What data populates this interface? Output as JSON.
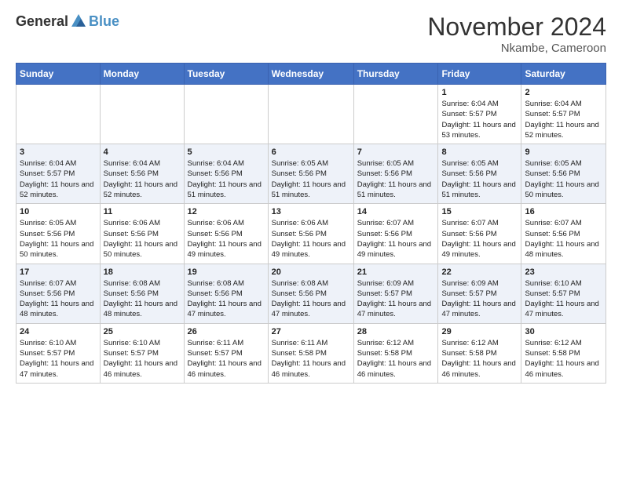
{
  "header": {
    "logo_general": "General",
    "logo_blue": "Blue",
    "month": "November 2024",
    "location": "Nkambe, Cameroon"
  },
  "weekdays": [
    "Sunday",
    "Monday",
    "Tuesday",
    "Wednesday",
    "Thursday",
    "Friday",
    "Saturday"
  ],
  "weeks": [
    [
      {
        "day": "",
        "sunrise": "",
        "sunset": "",
        "daylight": ""
      },
      {
        "day": "",
        "sunrise": "",
        "sunset": "",
        "daylight": ""
      },
      {
        "day": "",
        "sunrise": "",
        "sunset": "",
        "daylight": ""
      },
      {
        "day": "",
        "sunrise": "",
        "sunset": "",
        "daylight": ""
      },
      {
        "day": "",
        "sunrise": "",
        "sunset": "",
        "daylight": ""
      },
      {
        "day": "1",
        "sunrise": "Sunrise: 6:04 AM",
        "sunset": "Sunset: 5:57 PM",
        "daylight": "Daylight: 11 hours and 53 minutes."
      },
      {
        "day": "2",
        "sunrise": "Sunrise: 6:04 AM",
        "sunset": "Sunset: 5:57 PM",
        "daylight": "Daylight: 11 hours and 52 minutes."
      }
    ],
    [
      {
        "day": "3",
        "sunrise": "Sunrise: 6:04 AM",
        "sunset": "Sunset: 5:57 PM",
        "daylight": "Daylight: 11 hours and 52 minutes."
      },
      {
        "day": "4",
        "sunrise": "Sunrise: 6:04 AM",
        "sunset": "Sunset: 5:56 PM",
        "daylight": "Daylight: 11 hours and 52 minutes."
      },
      {
        "day": "5",
        "sunrise": "Sunrise: 6:04 AM",
        "sunset": "Sunset: 5:56 PM",
        "daylight": "Daylight: 11 hours and 51 minutes."
      },
      {
        "day": "6",
        "sunrise": "Sunrise: 6:05 AM",
        "sunset": "Sunset: 5:56 PM",
        "daylight": "Daylight: 11 hours and 51 minutes."
      },
      {
        "day": "7",
        "sunrise": "Sunrise: 6:05 AM",
        "sunset": "Sunset: 5:56 PM",
        "daylight": "Daylight: 11 hours and 51 minutes."
      },
      {
        "day": "8",
        "sunrise": "Sunrise: 6:05 AM",
        "sunset": "Sunset: 5:56 PM",
        "daylight": "Daylight: 11 hours and 51 minutes."
      },
      {
        "day": "9",
        "sunrise": "Sunrise: 6:05 AM",
        "sunset": "Sunset: 5:56 PM",
        "daylight": "Daylight: 11 hours and 50 minutes."
      }
    ],
    [
      {
        "day": "10",
        "sunrise": "Sunrise: 6:05 AM",
        "sunset": "Sunset: 5:56 PM",
        "daylight": "Daylight: 11 hours and 50 minutes."
      },
      {
        "day": "11",
        "sunrise": "Sunrise: 6:06 AM",
        "sunset": "Sunset: 5:56 PM",
        "daylight": "Daylight: 11 hours and 50 minutes."
      },
      {
        "day": "12",
        "sunrise": "Sunrise: 6:06 AM",
        "sunset": "Sunset: 5:56 PM",
        "daylight": "Daylight: 11 hours and 49 minutes."
      },
      {
        "day": "13",
        "sunrise": "Sunrise: 6:06 AM",
        "sunset": "Sunset: 5:56 PM",
        "daylight": "Daylight: 11 hours and 49 minutes."
      },
      {
        "day": "14",
        "sunrise": "Sunrise: 6:07 AM",
        "sunset": "Sunset: 5:56 PM",
        "daylight": "Daylight: 11 hours and 49 minutes."
      },
      {
        "day": "15",
        "sunrise": "Sunrise: 6:07 AM",
        "sunset": "Sunset: 5:56 PM",
        "daylight": "Daylight: 11 hours and 49 minutes."
      },
      {
        "day": "16",
        "sunrise": "Sunrise: 6:07 AM",
        "sunset": "Sunset: 5:56 PM",
        "daylight": "Daylight: 11 hours and 48 minutes."
      }
    ],
    [
      {
        "day": "17",
        "sunrise": "Sunrise: 6:07 AM",
        "sunset": "Sunset: 5:56 PM",
        "daylight": "Daylight: 11 hours and 48 minutes."
      },
      {
        "day": "18",
        "sunrise": "Sunrise: 6:08 AM",
        "sunset": "Sunset: 5:56 PM",
        "daylight": "Daylight: 11 hours and 48 minutes."
      },
      {
        "day": "19",
        "sunrise": "Sunrise: 6:08 AM",
        "sunset": "Sunset: 5:56 PM",
        "daylight": "Daylight: 11 hours and 47 minutes."
      },
      {
        "day": "20",
        "sunrise": "Sunrise: 6:08 AM",
        "sunset": "Sunset: 5:56 PM",
        "daylight": "Daylight: 11 hours and 47 minutes."
      },
      {
        "day": "21",
        "sunrise": "Sunrise: 6:09 AM",
        "sunset": "Sunset: 5:57 PM",
        "daylight": "Daylight: 11 hours and 47 minutes."
      },
      {
        "day": "22",
        "sunrise": "Sunrise: 6:09 AM",
        "sunset": "Sunset: 5:57 PM",
        "daylight": "Daylight: 11 hours and 47 minutes."
      },
      {
        "day": "23",
        "sunrise": "Sunrise: 6:10 AM",
        "sunset": "Sunset: 5:57 PM",
        "daylight": "Daylight: 11 hours and 47 minutes."
      }
    ],
    [
      {
        "day": "24",
        "sunrise": "Sunrise: 6:10 AM",
        "sunset": "Sunset: 5:57 PM",
        "daylight": "Daylight: 11 hours and 47 minutes."
      },
      {
        "day": "25",
        "sunrise": "Sunrise: 6:10 AM",
        "sunset": "Sunset: 5:57 PM",
        "daylight": "Daylight: 11 hours and 46 minutes."
      },
      {
        "day": "26",
        "sunrise": "Sunrise: 6:11 AM",
        "sunset": "Sunset: 5:57 PM",
        "daylight": "Daylight: 11 hours and 46 minutes."
      },
      {
        "day": "27",
        "sunrise": "Sunrise: 6:11 AM",
        "sunset": "Sunset: 5:58 PM",
        "daylight": "Daylight: 11 hours and 46 minutes."
      },
      {
        "day": "28",
        "sunrise": "Sunrise: 6:12 AM",
        "sunset": "Sunset: 5:58 PM",
        "daylight": "Daylight: 11 hours and 46 minutes."
      },
      {
        "day": "29",
        "sunrise": "Sunrise: 6:12 AM",
        "sunset": "Sunset: 5:58 PM",
        "daylight": "Daylight: 11 hours and 46 minutes."
      },
      {
        "day": "30",
        "sunrise": "Sunrise: 6:12 AM",
        "sunset": "Sunset: 5:58 PM",
        "daylight": "Daylight: 11 hours and 46 minutes."
      }
    ]
  ]
}
